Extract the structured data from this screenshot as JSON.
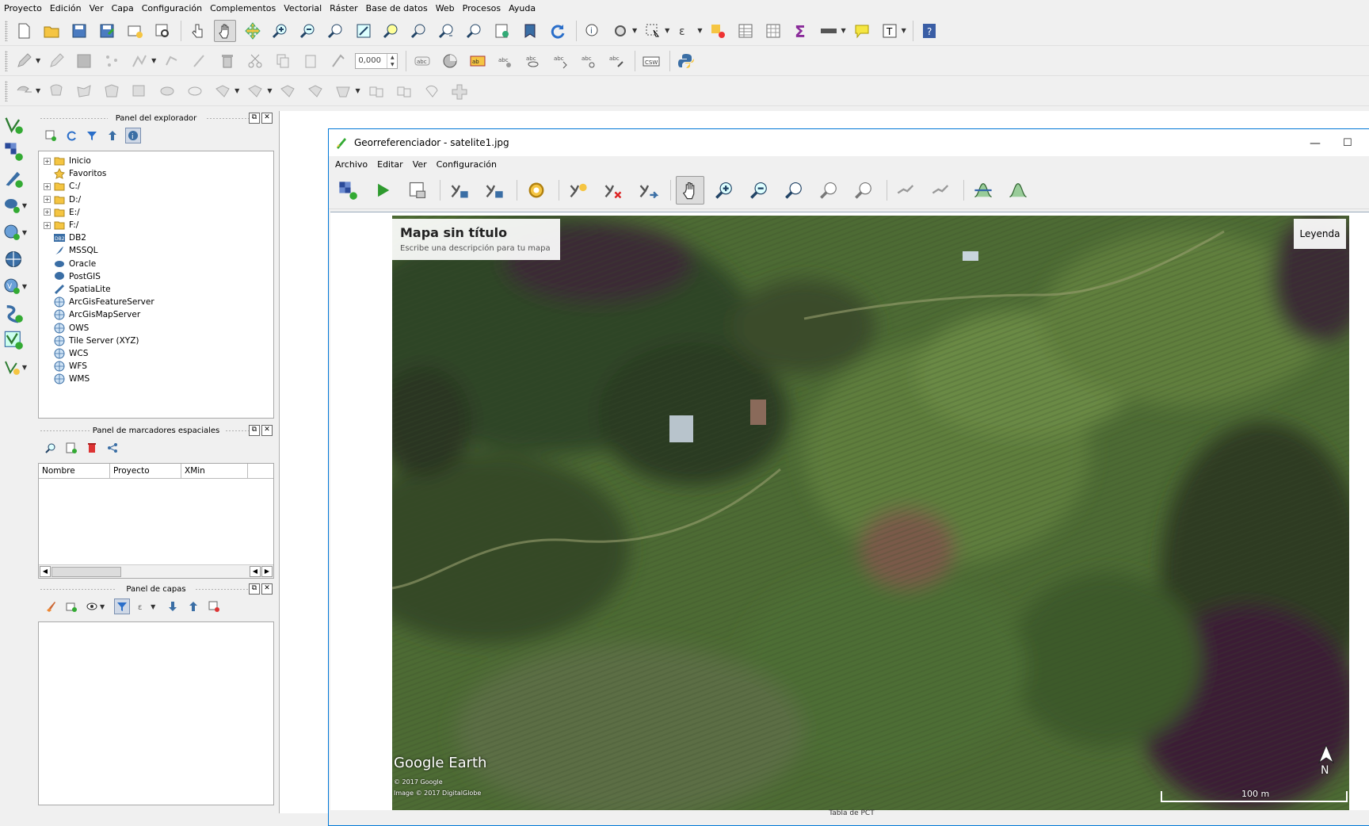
{
  "menu": [
    "Proyecto",
    "Edición",
    "Ver",
    "Capa",
    "Configuración",
    "Complementos",
    "Vectorial",
    "Ráster",
    "Base de datos",
    "Web",
    "Procesos",
    "Ayuda"
  ],
  "toolbar2": {
    "scale_value": "0,000",
    "csw_label": "CSW"
  },
  "browser_panel": {
    "title": "Panel del explorador",
    "items": [
      {
        "label": "Inicio",
        "expandable": true,
        "icon": "folder-icon"
      },
      {
        "label": "Favoritos",
        "expandable": false,
        "icon": "star-icon"
      },
      {
        "label": "C:/",
        "expandable": true,
        "icon": "folder-icon"
      },
      {
        "label": "D:/",
        "expandable": true,
        "icon": "folder-icon"
      },
      {
        "label": "E:/",
        "expandable": true,
        "icon": "folder-icon"
      },
      {
        "label": "F:/",
        "expandable": true,
        "icon": "folder-icon"
      },
      {
        "label": "DB2",
        "expandable": false,
        "icon": "db2-icon"
      },
      {
        "label": "MSSQL",
        "expandable": false,
        "icon": "mssql-icon"
      },
      {
        "label": "Oracle",
        "expandable": false,
        "icon": "oracle-icon"
      },
      {
        "label": "PostGIS",
        "expandable": false,
        "icon": "postgis-icon"
      },
      {
        "label": "SpatiaLite",
        "expandable": false,
        "icon": "spatialite-icon"
      },
      {
        "label": "ArcGisFeatureServer",
        "expandable": false,
        "icon": "globe-icon"
      },
      {
        "label": "ArcGisMapServer",
        "expandable": false,
        "icon": "globe-icon"
      },
      {
        "label": "OWS",
        "expandable": false,
        "icon": "globe-icon"
      },
      {
        "label": "Tile Server (XYZ)",
        "expandable": false,
        "icon": "globe-icon"
      },
      {
        "label": "WCS",
        "expandable": false,
        "icon": "globe-icon"
      },
      {
        "label": "WFS",
        "expandable": false,
        "icon": "globe-icon"
      },
      {
        "label": "WMS",
        "expandable": false,
        "icon": "globe-icon"
      }
    ]
  },
  "bookmarks_panel": {
    "title": "Panel de marcadores espaciales",
    "columns": [
      "Nombre",
      "Proyecto",
      "XMin"
    ]
  },
  "layers_panel": {
    "title": "Panel de capas"
  },
  "georef": {
    "title": "Georreferenciador - satelite1.jpg",
    "menu": [
      "Archivo",
      "Editar",
      "Ver",
      "Configuración"
    ],
    "map_title": "Mapa sin título",
    "map_desc": "Escribe una descripción para tu mapa",
    "legend_button": "Leyenda",
    "watermark": "Google Earth",
    "copyright1": "© 2017 Google",
    "copyright2": "Image © 2017 DigitalGlobe",
    "scale_label": "100 m",
    "north_label": "N",
    "bottom_panel": "Tabla de PCT"
  },
  "colors": {
    "accent": "#0078d7",
    "folder": "#f5c542",
    "green_icon": "#2a8a2a"
  }
}
